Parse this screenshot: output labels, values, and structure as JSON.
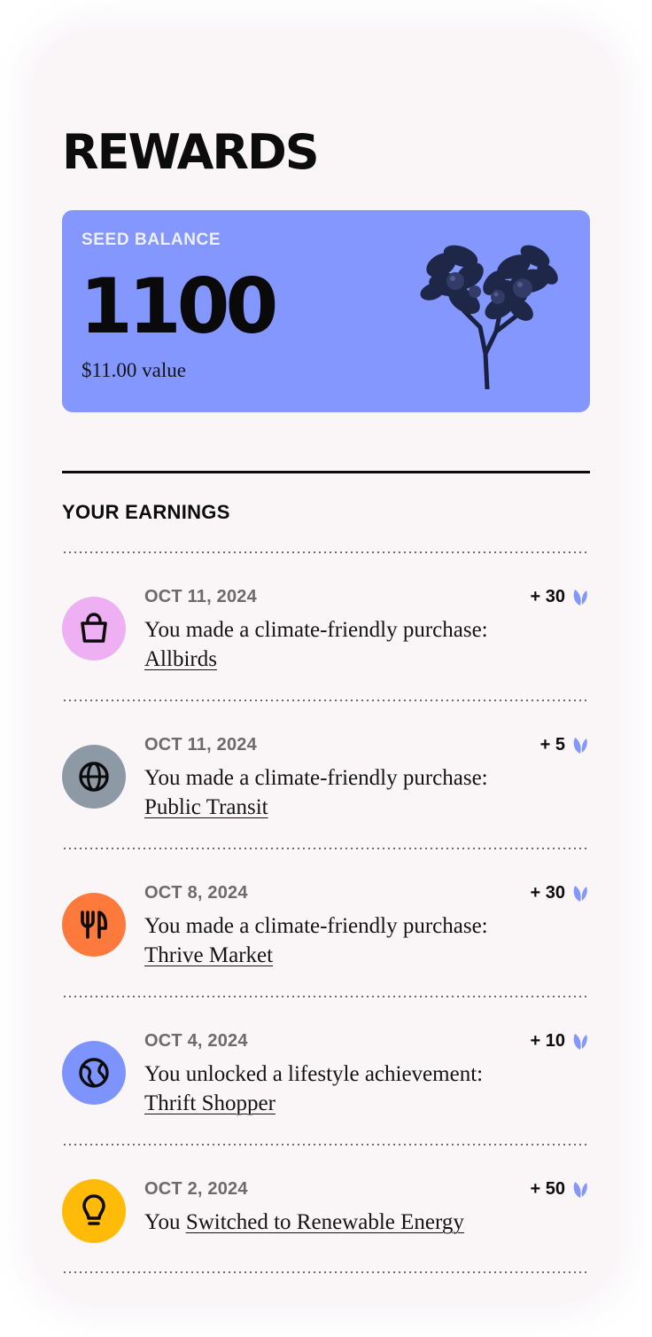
{
  "header": {
    "title": "REWARDS"
  },
  "balance": {
    "label": "SEED BALANCE",
    "value": "1100",
    "sub": "$11.00 value"
  },
  "earnings": {
    "title": "YOUR EARNINGS",
    "items": [
      {
        "date": "OCT 11, 2024",
        "points": "+ 30",
        "prefix": "You made a climate-friendly purchase:",
        "link": "Allbirds",
        "icon": "shopping-bag-icon",
        "color": "#eeb0f2"
      },
      {
        "date": "OCT 11, 2024",
        "points": "+ 5",
        "prefix": "You made a climate-friendly purchase:",
        "link": "Public Transit",
        "icon": "globe-icon",
        "color": "#8e99a6"
      },
      {
        "date": "OCT 8, 2024",
        "points": "+ 30",
        "prefix": "You made a climate-friendly purchase:",
        "link": "Thrive Market",
        "icon": "fork-knife-icon",
        "color": "#fd7a3c"
      },
      {
        "date": "OCT 4, 2024",
        "points": "+ 10",
        "prefix": "You unlocked a lifestyle achievement:",
        "link": "Thrift Shopper",
        "icon": "earth-icon",
        "color": "#7d94fe"
      },
      {
        "date": "OCT 2, 2024",
        "points": "+ 50",
        "prefix": "You",
        "link": "Switched to Renewable Energy",
        "icon": "lightbulb-icon",
        "color": "#ffbb08"
      }
    ]
  },
  "colors": {
    "card": "#8397ff",
    "background": "#faf6f8",
    "seed": "#8397ff"
  }
}
